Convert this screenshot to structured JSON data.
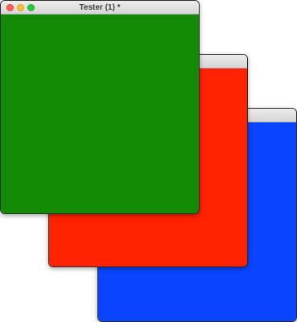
{
  "windows": {
    "front": {
      "title": "Tester (1) *",
      "content_color": "#138a03"
    },
    "middle": {
      "title": "",
      "content_color": "#ff2200"
    },
    "back": {
      "title": "",
      "content_color": "#0a44ff"
    }
  },
  "titlebar_buttons": [
    "close-icon",
    "minimize-icon",
    "zoom-icon"
  ]
}
